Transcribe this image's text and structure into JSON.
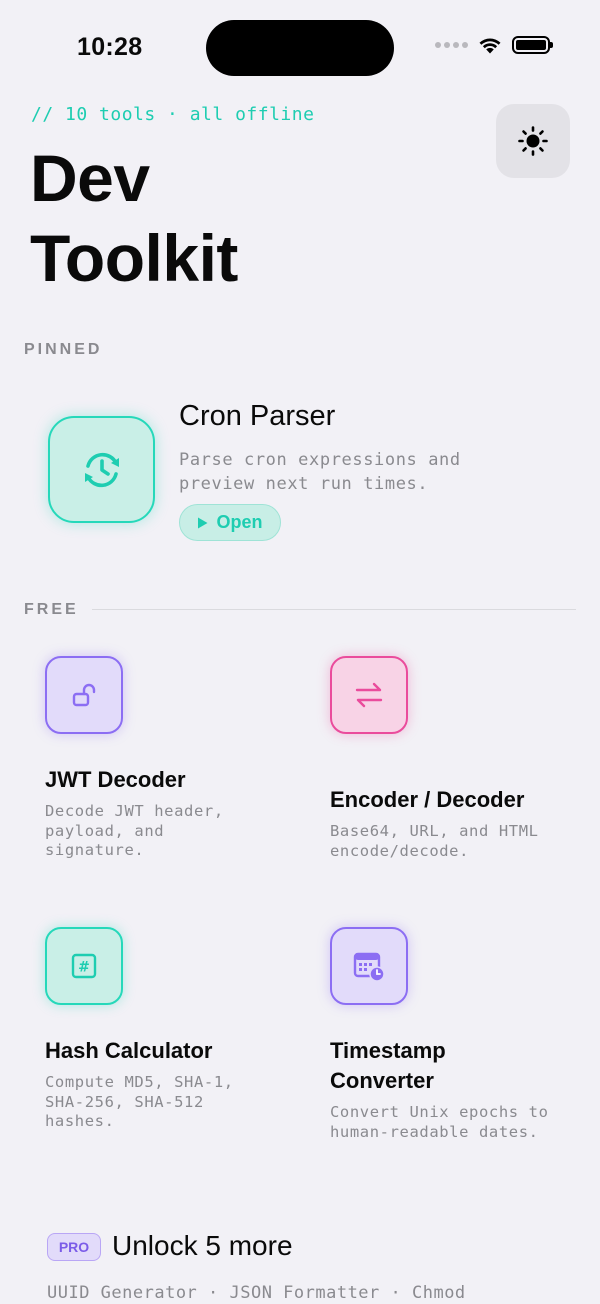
{
  "status_bar": {
    "time": "10:28"
  },
  "header": {
    "subtitle": "// 10 tools · all offline",
    "title_line1": "Dev",
    "title_line2": "Toolkit",
    "theme_icon": "sun-icon"
  },
  "pinned": {
    "section_label": "PINNED",
    "tool": {
      "title": "Cron Parser",
      "description": "Parse cron expressions and preview next run times.",
      "icon": "clock-refresh-icon",
      "open_label": "Open",
      "accent": "#26d8ba"
    }
  },
  "free": {
    "section_label": "FREE",
    "tools": [
      {
        "title": "JWT Decoder",
        "description": "Decode JWT header, payload, and signature.",
        "icon": "unlock-icon",
        "accent": "#8c6ef3"
      },
      {
        "title": "Encoder / Decoder",
        "description": "Base64, URL, and HTML encode/decode.",
        "icon": "swap-arrows-icon",
        "accent": "#ea4c9c"
      },
      {
        "title": "Hash Calculator",
        "description": "Compute MD5, SHA-1, SHA-256, SHA-512 hashes.",
        "icon": "hash-icon",
        "accent": "#26d8ba"
      },
      {
        "title": "Timestamp Converter",
        "description": "Convert Unix epochs to human-readable dates.",
        "icon": "calendar-clock-icon",
        "accent": "#8c6ef3"
      }
    ]
  },
  "unlock": {
    "badge": "PRO",
    "title": "Unlock 5 more",
    "list": "UUID Generator · JSON Formatter · Chmod"
  }
}
